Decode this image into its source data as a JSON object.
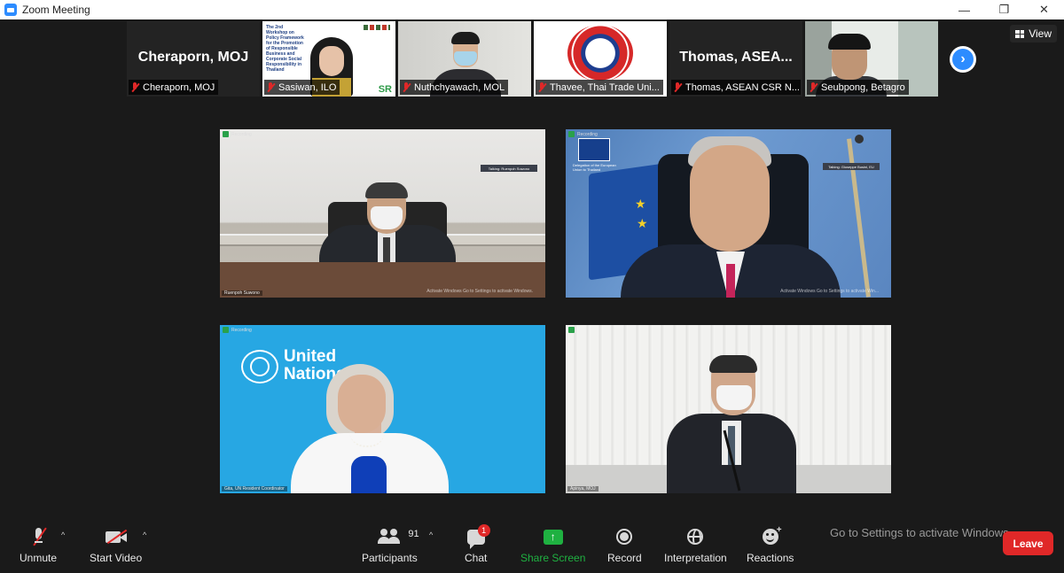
{
  "window": {
    "title": "Zoom Meeting",
    "controls": [
      "—",
      "❐",
      "✕"
    ]
  },
  "view_button": {
    "label": "View"
  },
  "thumbnails": [
    {
      "name": "Cheraporn, MOJ",
      "display_name": "Cheraporn, MOJ",
      "muted": true
    },
    {
      "name": "Sasiwan, ILO",
      "muted": true,
      "slide_text": "The 2nd Workshop on Policy Framework for the Promotion of Responsible Business and Corporate Social Responsibility in Thailand",
      "slide_badge": "SR"
    },
    {
      "name": "Nuthchyawach, MOL",
      "muted": true
    },
    {
      "name": "Thavee, Thai Trade Uni...",
      "muted": true
    },
    {
      "name": "Thomas, ASEAN CSR N...",
      "display_name": "Thomas,  ASEA...",
      "muted": true
    },
    {
      "name": "Seubpong, Betagro",
      "muted": true
    }
  ],
  "tiles": [
    {
      "status": "Recording",
      "caption": "Ruenpoh Suwono",
      "nameplate": "Talking: Ruenpoh Suwono",
      "watermark": "Activate Windows\nGo to Settings to activate Windows."
    },
    {
      "status": "Recording",
      "caption": "",
      "nameplate": "Talking: Giuseppe Busini, EU",
      "emblem_text": "Delegation of the European Union to Thailand",
      "watermark": "Activate Windows\nGo to Settings to activate Win..."
    },
    {
      "status": "Recording",
      "caption": "Gita, UN Resident Coordinator",
      "logo_text": "United\nNations"
    },
    {
      "status": "",
      "caption": "Apinya, MOJ"
    }
  ],
  "toolbar": {
    "unmute": "Unmute",
    "start_video": "Start Video",
    "participants": "Participants",
    "participant_count": "91",
    "chat": "Chat",
    "chat_badge": "1",
    "share_screen": "Share Screen",
    "record": "Record",
    "interpretation": "Interpretation",
    "reactions": "Reactions",
    "leave": "Leave",
    "activation_notice": "Go to Settings to activate Windows.",
    "caret": "^"
  },
  "colors": {
    "zoom_blue": "#2d8cff",
    "share_green": "#1fb141",
    "leave_red": "#e02828",
    "background": "#1a1a1a"
  }
}
